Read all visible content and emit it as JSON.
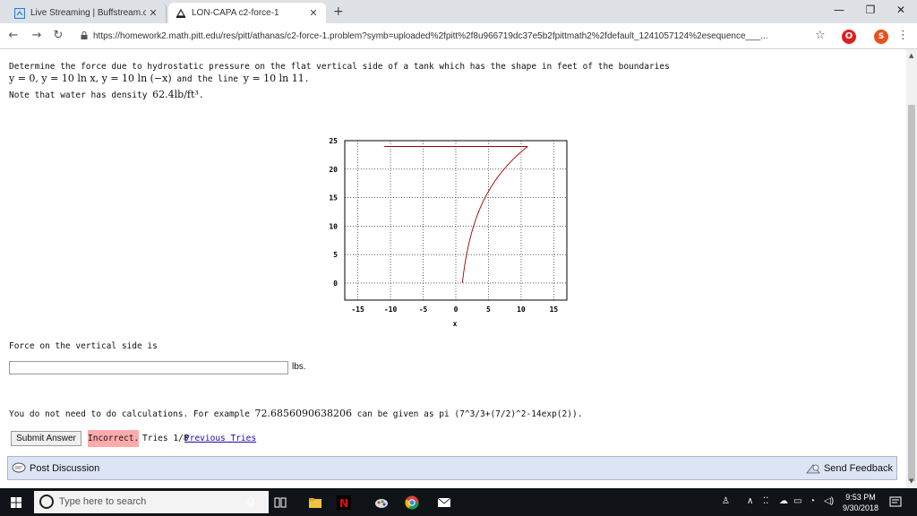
{
  "browser": {
    "tabs": [
      {
        "title": "Live Streaming | Buffstream.com"
      },
      {
        "title": "LON-CAPA c2-force-1"
      }
    ],
    "new_tab": "+",
    "url": "https://homework2.math.pitt.edu/res/pitt/athanas/c2-force-1.problem?symb=uploaded%2fpitt%2f8u966719dc37e5b2fpittmath2%2fdefault_1241057124%2esequence___...",
    "ext_opera": "O",
    "ext_s": "S"
  },
  "problem": {
    "line1": "Determine the force due to hydrostatic pressure on the flat vertical side of a tank which has the shape in feet of the boundaries",
    "line2_eqs": "y = 0,  y = 10 ln x,  y = 10 ln (−x)",
    "line2_mid": " and the line ",
    "line2_eq2": "y = 10 ln 11",
    "line2_end": ".",
    "line3_pre": "Note that water has density ",
    "line3_density": "62.4lb/ft³",
    "line3_end": "."
  },
  "chart_data": {
    "type": "line",
    "xlabel": "x",
    "ylabel": "",
    "xlim": [
      -17,
      17
    ],
    "ylim": [
      -3,
      25
    ],
    "x_ticks": [
      "-15",
      "-10",
      "-5",
      "0",
      "5",
      "10",
      "15"
    ],
    "y_ticks": [
      "25",
      "20",
      "15",
      "10",
      "5",
      "0"
    ],
    "grid": true,
    "series": [
      {
        "fn": "10 ln x",
        "x_range": [
          1,
          11
        ]
      },
      {
        "fn": "10 ln (-x)",
        "x_range": [
          -11,
          -1
        ]
      },
      {
        "fn": "10 ln 11",
        "x_range": [
          -11,
          11
        ]
      }
    ],
    "color": "#990000"
  },
  "answer": {
    "prompt": "Force on the vertical side is",
    "value": "",
    "unit": "lbs.",
    "hint_pre": "You do not need to do calculations. For example ",
    "hint_num": "72.6856090638206",
    "hint_post": " can be given as pi (7^3/3+(7/2)^2-14exp(2))."
  },
  "actions": {
    "submit": "Submit Answer",
    "status": "Incorrect.",
    "tries": "Tries 1/8",
    "previous": "Previous Tries",
    "post_discussion": "Post Discussion",
    "send_feedback": "Send Feedback"
  },
  "taskbar": {
    "search_placeholder": "Type here to search",
    "time": "9:53 PM",
    "date": "9/30/2018"
  }
}
